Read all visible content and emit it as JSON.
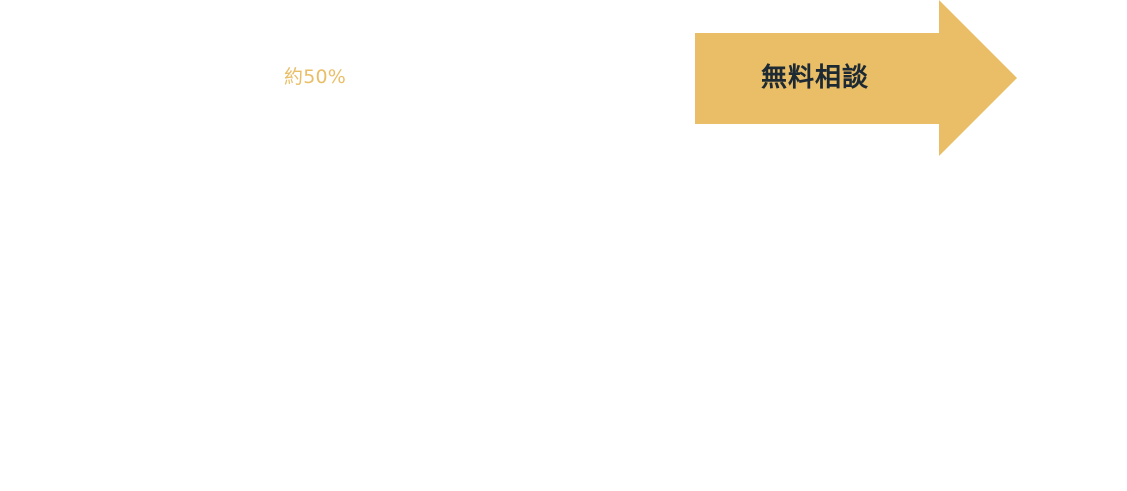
{
  "stat": {
    "label": "約50%"
  },
  "cta": {
    "label": "無料相談"
  },
  "colors": {
    "accent": "#E9BE67",
    "cta_text": "#1E2A33",
    "background": "#FFFFFF"
  },
  "icons": {
    "cta_shape": "right-arrow-icon"
  }
}
